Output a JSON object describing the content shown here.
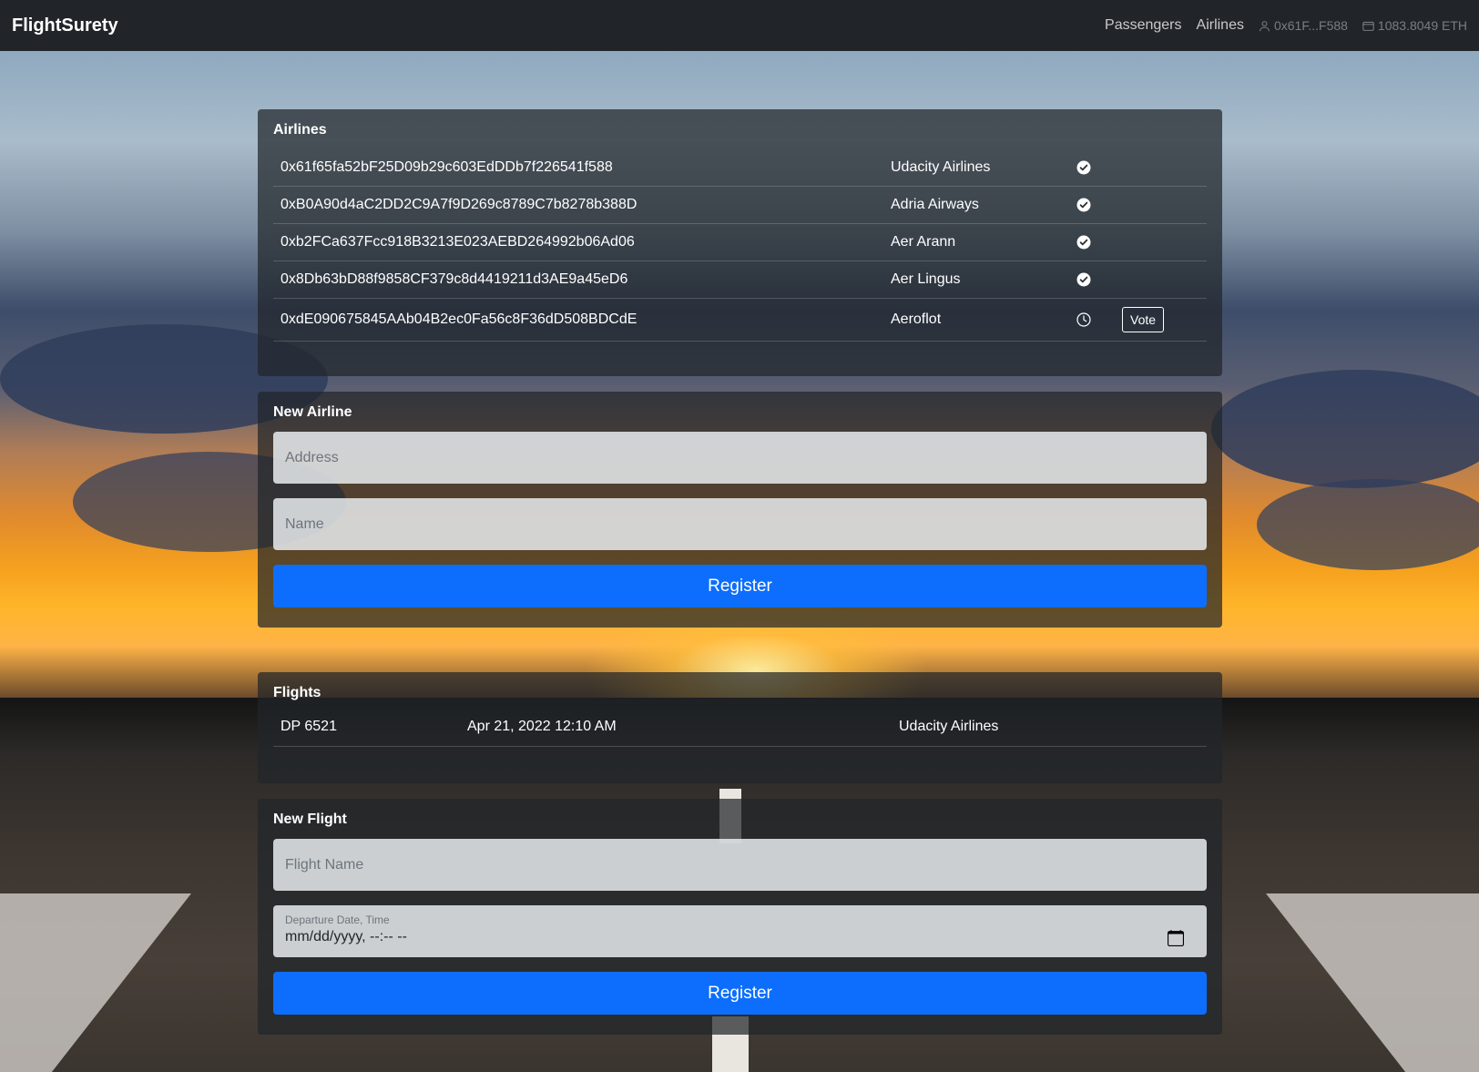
{
  "nav": {
    "brand": "FlightSurety",
    "links": [
      "Passengers",
      "Airlines"
    ],
    "account": "0x61F...F588",
    "balance": "1083.8049 ETH"
  },
  "airlines_card": {
    "title": "Airlines",
    "rows": [
      {
        "address": "0x61f65fa52bF25D09b29c603EdDDb7f226541f588",
        "name": "Udacity Airlines",
        "status": "check-circle-icon"
      },
      {
        "address": "0xB0A90d4aC2DD2C9A7f9D269c8789C7b8278b388D",
        "name": "Adria Airways",
        "status": "check-circle-icon"
      },
      {
        "address": "0xb2FCa637Fcc918B3213E023AEBD264992b06Ad06",
        "name": "Aer Arann",
        "status": "check-circle-icon"
      },
      {
        "address": "0x8Db63bD88f9858CF379c8d4419211d3AE9a45eD6",
        "name": "Aer Lingus",
        "status": "check-circle-icon"
      },
      {
        "address": "0xdE090675845AAb04B2ec0Fa56c8F36dD508BDCdE",
        "name": "Aeroflot",
        "status": "clock-icon",
        "action": "Vote"
      }
    ]
  },
  "new_airline": {
    "title": "New Airline",
    "address_placeholder": "Address",
    "name_placeholder": "Name",
    "button": "Register"
  },
  "flights_card": {
    "title": "Flights",
    "rows": [
      {
        "code": "DP 6521",
        "departure": "Apr 21, 2022 12:10 AM",
        "airline": "Udacity Airlines"
      }
    ]
  },
  "new_flight": {
    "title": "New Flight",
    "name_placeholder": "Flight Name",
    "date_label": "Departure Date, Time",
    "date_value": "mm/dd/yyyy, --:-- --",
    "button": "Register"
  },
  "colors": {
    "navbar": "#212529",
    "primary": "#0d6efd"
  }
}
